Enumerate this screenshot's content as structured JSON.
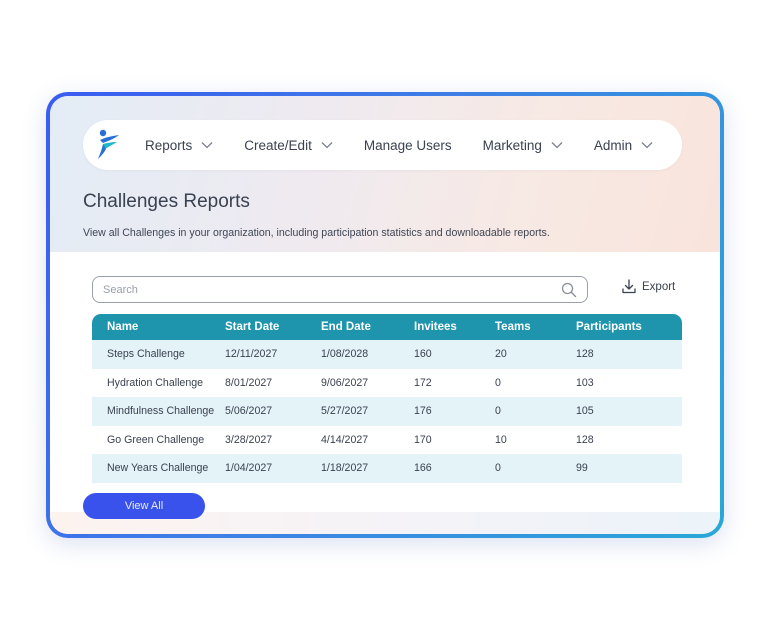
{
  "nav": {
    "items": [
      {
        "label": "Reports",
        "has_dropdown": true
      },
      {
        "label": "Create/Edit",
        "has_dropdown": true
      },
      {
        "label": "Manage Users",
        "has_dropdown": false
      },
      {
        "label": "Marketing",
        "has_dropdown": true
      },
      {
        "label": "Admin",
        "has_dropdown": true
      }
    ]
  },
  "page": {
    "title": "Challenges Reports",
    "description": "View all Challenges in your organization, including participation statistics and downloadable reports."
  },
  "search": {
    "placeholder": "Search",
    "value": ""
  },
  "export": {
    "label": "Export",
    "icon": "download-icon"
  },
  "table": {
    "columns": [
      "Name",
      "Start Date",
      "End Date",
      "Invitees",
      "Teams",
      "Participants"
    ],
    "rows": [
      [
        "Steps Challenge",
        "12/11/2027",
        "1/08/2028",
        "160",
        "20",
        "128"
      ],
      [
        "Hydration Challenge",
        "8/01/2027",
        "9/06/2027",
        "172",
        "0",
        "103"
      ],
      [
        "Mindfulness Challenge",
        "5/06/2027",
        "5/27/2027",
        "176",
        "0",
        "105"
      ],
      [
        "Go Green Challenge",
        "3/28/2027",
        "4/14/2027",
        "170",
        "10",
        "128"
      ],
      [
        "New Years Challenge",
        "1/04/2027",
        "1/18/2027",
        "166",
        "0",
        "99"
      ]
    ]
  },
  "actions": {
    "view_all_label": "View All"
  },
  "colors": {
    "frame_border_start": "#3b5bf0",
    "frame_border_end": "#29a8d6",
    "table_header": "#1e95ad",
    "row_stripe": "#e4f3f8",
    "button": "#3a52ec",
    "logo_primary": "#2a6fd6",
    "logo_accent": "#1fb7c9"
  }
}
